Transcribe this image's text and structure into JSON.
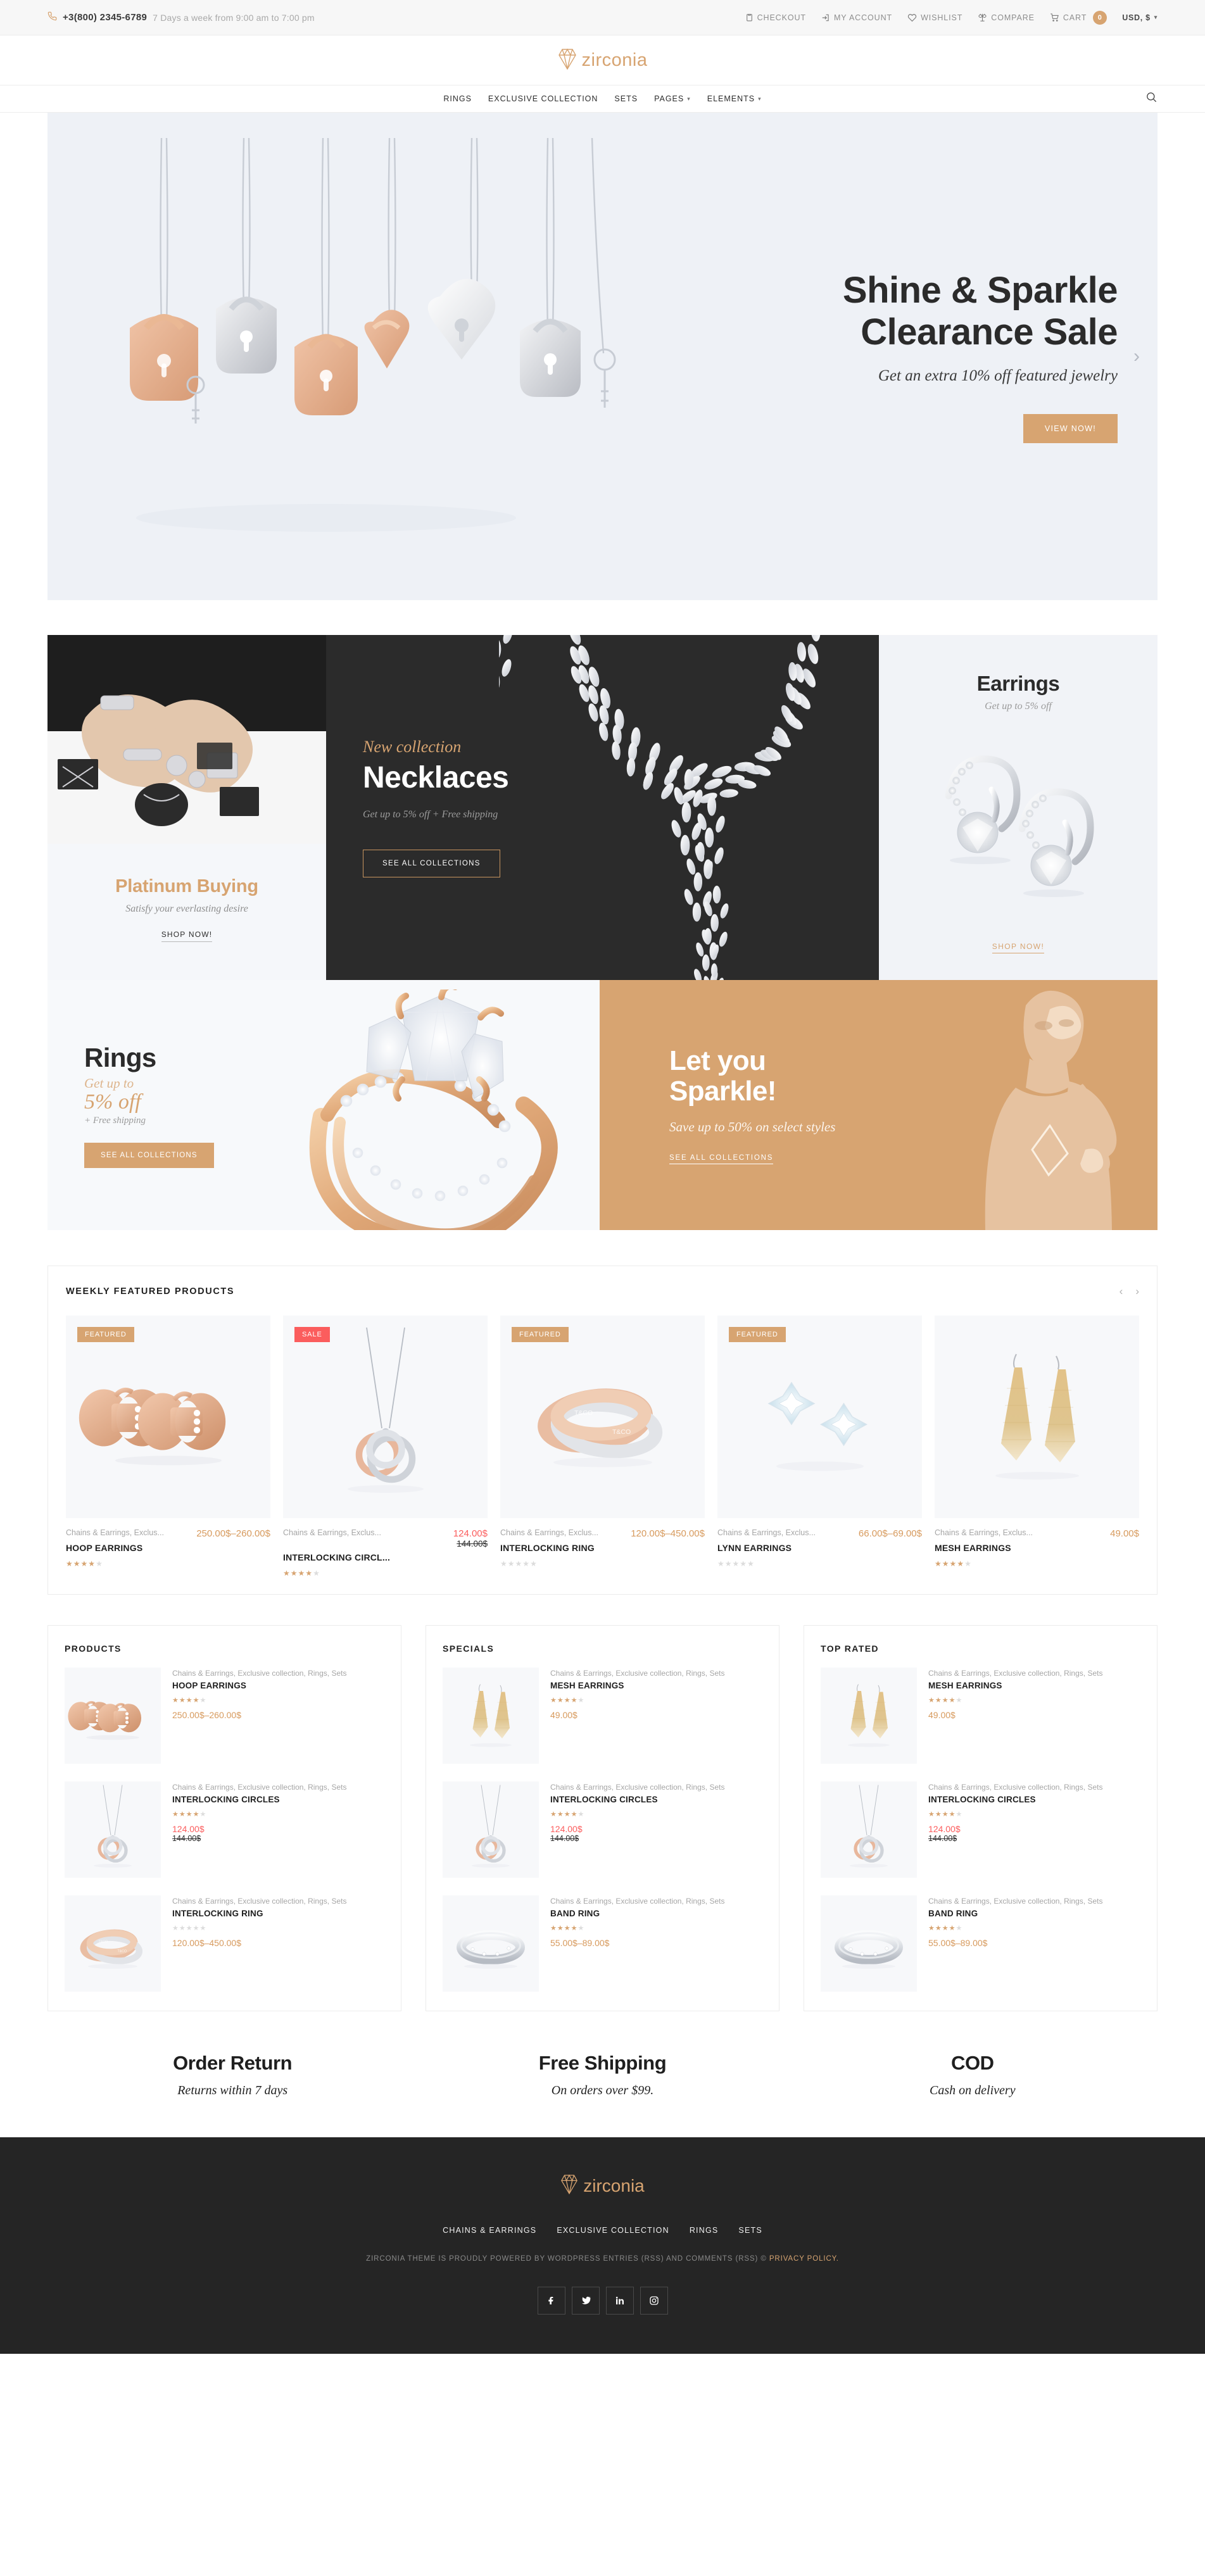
{
  "topbar": {
    "phone": "+3(800) 2345-6789",
    "hours": "7 Days a week from 9:00 am to 7:00 pm",
    "links": [
      {
        "label": "CHECKOUT",
        "icon": "clipboard-icon"
      },
      {
        "label": "MY ACCOUNT",
        "icon": "login-icon"
      },
      {
        "label": "WISHLIST",
        "icon": "heart-icon"
      },
      {
        "label": "COMPARE",
        "icon": "scales-icon"
      }
    ],
    "cart_label": "CART",
    "cart_count": "0",
    "currency": "USD, $"
  },
  "brand": {
    "name": "zirconia",
    "accent": "#d7a471"
  },
  "nav": {
    "items": [
      {
        "label": "RINGS",
        "has_caret": false
      },
      {
        "label": "EXCLUSIVE COLLECTION",
        "has_caret": false
      },
      {
        "label": "SETS",
        "has_caret": false
      },
      {
        "label": "PAGES",
        "has_caret": true
      },
      {
        "label": "ELEMENTS",
        "has_caret": true
      }
    ],
    "search_icon": "search-icon"
  },
  "hero": {
    "title_line1": "Shine & Sparkle",
    "title_line2": "Clearance Sale",
    "subtitle": "Get an extra 10% off featured jewelry",
    "cta": "VIEW NOW!"
  },
  "promos": {
    "platinum": {
      "title": "Platinum Buying",
      "subtitle": "Satisfy your everlasting desire",
      "link": "SHOP NOW!"
    },
    "necklaces": {
      "eyebrow": "New collection",
      "title": "Necklaces",
      "subtitle": "Get up to 5% off + Free shipping",
      "button": "SEE ALL COLLECTIONS"
    },
    "earrings": {
      "title": "Earrings",
      "subtitle": "Get up to 5% off",
      "link": "SHOP NOW!"
    },
    "rings": {
      "title": "Rings",
      "line1": "Get up to",
      "line2": "5% off",
      "line3": "+ Free shipping",
      "button": "SEE ALL COLLECTIONS"
    },
    "sparkle": {
      "title_line1": "Let you",
      "title_line2": "Sparkle!",
      "subtitle": "Save up to 50%  on select styles",
      "link": "SEE ALL COLLECTIONS"
    }
  },
  "featured": {
    "title": "WEEKLY FEATURED PRODUCTS",
    "prev": "‹",
    "next": "›",
    "items": [
      {
        "badge": "FEATURED",
        "badge_type": "featured",
        "category": "Chains & Earrings, Exclus...",
        "name": "HOOP EARRINGS",
        "price": "250.00$–260.00$",
        "sale_price": null,
        "old_price": null,
        "stars": 4,
        "art": "hoop-earrings"
      },
      {
        "badge": "SALE",
        "badge_type": "sale",
        "category": "Chains & Earrings, Exclus...",
        "name": "INTERLOCKING CIRCL...",
        "price": null,
        "sale_price": "124.00$",
        "old_price": "144.00$",
        "stars": 4,
        "art": "interlocking-circles"
      },
      {
        "badge": "FEATURED",
        "badge_type": "featured",
        "category": "Chains & Earrings, Exclus...",
        "name": "INTERLOCKING RING",
        "price": "120.00$–450.00$",
        "sale_price": null,
        "old_price": null,
        "stars": 0,
        "art": "interlocking-ring"
      },
      {
        "badge": "FEATURED",
        "badge_type": "featured",
        "category": "Chains & Earrings, Exclus...",
        "name": "LYNN EARRINGS",
        "price": "66.00$–69.00$",
        "sale_price": null,
        "old_price": null,
        "stars": 0,
        "art": "lynn-earrings"
      },
      {
        "badge": null,
        "badge_type": null,
        "category": "Chains & Earrings, Exclus...",
        "name": "MESH EARRINGS",
        "price": "49.00$",
        "sale_price": null,
        "old_price": null,
        "stars": 3.5,
        "art": "mesh-earrings"
      }
    ]
  },
  "columns": [
    {
      "title": "PRODUCTS",
      "items": [
        {
          "category": "Chains & Earrings, Exclusive collection, Rings, Sets",
          "name": "HOOP EARRINGS",
          "stars": 4,
          "price": "250.00$–260.00$",
          "sale_price": null,
          "old_price": null,
          "art": "hoop-earrings"
        },
        {
          "category": "Chains & Earrings, Exclusive collection, Rings, Sets",
          "name": "INTERLOCKING CIRCLES",
          "stars": 4,
          "price": null,
          "sale_price": "124.00$",
          "old_price": "144.00$",
          "art": "interlocking-circles"
        },
        {
          "category": "Chains & Earrings, Exclusive collection, Rings, Sets",
          "name": "INTERLOCKING RING",
          "stars": 0,
          "price": "120.00$–450.00$",
          "sale_price": null,
          "old_price": null,
          "art": "interlocking-ring"
        }
      ]
    },
    {
      "title": "SPECIALS",
      "items": [
        {
          "category": "Chains & Earrings, Exclusive collection, Rings, Sets",
          "name": "MESH EARRINGS",
          "stars": 3.5,
          "price": "49.00$",
          "sale_price": null,
          "old_price": null,
          "art": "mesh-earrings"
        },
        {
          "category": "Chains & Earrings, Exclusive collection, Rings, Sets",
          "name": "INTERLOCKING CIRCLES",
          "stars": 4,
          "price": null,
          "sale_price": "124.00$",
          "old_price": "144.00$",
          "art": "interlocking-circles"
        },
        {
          "category": "Chains & Earrings, Exclusive collection, Rings, Sets",
          "name": "BAND RING",
          "stars": 3.5,
          "price": "55.00$–89.00$",
          "sale_price": null,
          "old_price": null,
          "art": "band-ring"
        }
      ]
    },
    {
      "title": "TOP RATED",
      "items": [
        {
          "category": "Chains & Earrings, Exclusive collection, Rings, Sets",
          "name": "MESH EARRINGS",
          "stars": 3.5,
          "price": "49.00$",
          "sale_price": null,
          "old_price": null,
          "art": "mesh-earrings"
        },
        {
          "category": "Chains & Earrings, Exclusive collection, Rings, Sets",
          "name": "INTERLOCKING CIRCLES",
          "stars": 4,
          "price": null,
          "sale_price": "124.00$",
          "old_price": "144.00$",
          "art": "interlocking-circles"
        },
        {
          "category": "Chains & Earrings, Exclusive collection, Rings, Sets",
          "name": "BAND RING",
          "stars": 3.5,
          "price": "55.00$–89.00$",
          "sale_price": null,
          "old_price": null,
          "art": "band-ring"
        }
      ]
    }
  ],
  "services": [
    {
      "title": "Order Return",
      "subtitle": "Returns within 7 days"
    },
    {
      "title": "Free Shipping",
      "subtitle": "On orders over $99."
    },
    {
      "title": "COD",
      "subtitle": "Cash on delivery"
    }
  ],
  "footer": {
    "brand": "zirconia",
    "nav": [
      "CHAINS & EARRINGS",
      "EXCLUSIVE COLLECTION",
      "RINGS",
      "SETS"
    ],
    "copy_pre": "ZIRCONIA THEME IS PROUDLY POWERED BY WORDPRESS ENTRIES (RSS) AND COMMENTS (RSS) © ",
    "copy_link": "PRIVACY POLICY.",
    "social": [
      "facebook-icon",
      "twitter-icon",
      "linkedin-icon",
      "instagram-icon"
    ]
  }
}
